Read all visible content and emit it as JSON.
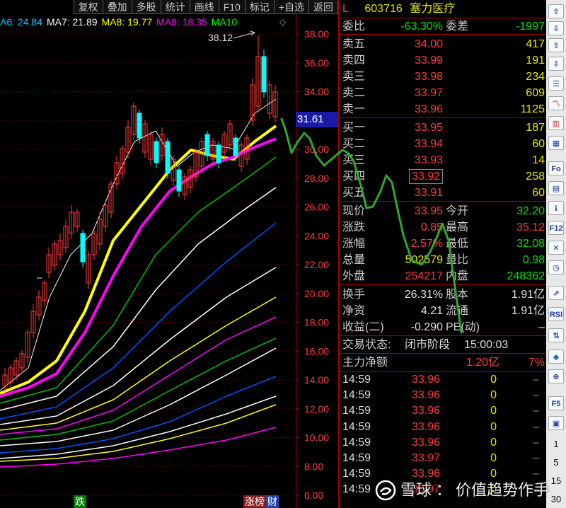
{
  "toolbar": {
    "items": [
      "复权",
      "叠加",
      "多股",
      "统计",
      "画线",
      "F10",
      "标记",
      "+自选",
      "返回"
    ]
  },
  "ma_legend": [
    {
      "label": "A6: 24.84",
      "color": "#00c8ff"
    },
    {
      "label": "MA7: 21.89",
      "color": "#ffffff"
    },
    {
      "label": "MA8: 19.77",
      "color": "#ffff00"
    },
    {
      "label": "MA9: 18.35",
      "color": "#ff00ff"
    },
    {
      "label": "MA10",
      "color": "#00ff00"
    }
  ],
  "legend_arrows": "◇",
  "chart": {
    "high_label": "38.12",
    "price_flag": "31.61",
    "y_ticks": [
      "38.00",
      "36.00",
      "34.00",
      "32.00",
      "30.00",
      "28.00",
      "26.00",
      "24.00",
      "22.00",
      "20.00",
      "18.00",
      "16.00",
      "14.00",
      "12.00",
      "10.00",
      "8.00",
      "6.00"
    ],
    "bottom_tags": [
      "跌",
      "涨榜",
      "财"
    ],
    "colors": {
      "up": "#ff3b3b",
      "down": "#00ffff",
      "axis": "#aa0000"
    }
  },
  "header": {
    "market": "L",
    "code": "603716",
    "name": "塞力医疗"
  },
  "ratio": {
    "label1": "委比",
    "value1": "-63.30%",
    "label2": "委差",
    "value2": "-1997"
  },
  "asks": [
    {
      "label": "卖五",
      "price": "34.00",
      "vol": "417"
    },
    {
      "label": "卖四",
      "price": "33.99",
      "vol": "191"
    },
    {
      "label": "卖三",
      "price": "33.98",
      "vol": "234"
    },
    {
      "label": "卖二",
      "price": "33.97",
      "vol": "609"
    },
    {
      "label": "卖一",
      "price": "33.96",
      "vol": "1125"
    }
  ],
  "bids": [
    {
      "label": "买一",
      "price": "33.95",
      "vol": "187"
    },
    {
      "label": "买二",
      "price": "33.94",
      "vol": "60"
    },
    {
      "label": "买三",
      "price": "33.93",
      "vol": "14"
    },
    {
      "label": "买四",
      "price": "33.92",
      "vol": "258"
    },
    {
      "label": "买五",
      "price": "33.91",
      "vol": "60"
    }
  ],
  "stats1": [
    {
      "l1": "现价",
      "v1": "33.95",
      "c1": "red",
      "l2": "今开",
      "v2": "32.20",
      "c2": "green"
    },
    {
      "l1": "涨跌",
      "v1": "0.85",
      "c1": "red",
      "l2": "最高",
      "v2": "35.12",
      "c2": "red"
    },
    {
      "l1": "涨幅",
      "v1": "2.57%",
      "c1": "red",
      "l2": "最低",
      "v2": "32.08",
      "c2": "green"
    },
    {
      "l1": "总量",
      "v1": "502579",
      "c1": "yellow",
      "l2": "量比",
      "v2": "0.98",
      "c2": "green"
    },
    {
      "l1": "外盘",
      "v1": "254217",
      "c1": "red",
      "l2": "内盘",
      "v2": "248362",
      "c2": "green"
    }
  ],
  "stats2": [
    {
      "l1": "换手",
      "v1": "26.31%",
      "l2": "股本",
      "v2": "1.91亿"
    },
    {
      "l1": "净资",
      "v1": "4.21",
      "l2": "流通",
      "v2": "1.91亿"
    },
    {
      "l1": "收益(二)",
      "v1": "-0.290",
      "l2": "PE(动)",
      "v2": "–"
    }
  ],
  "trade_status": {
    "label": "交易状态:",
    "value": "闭市阶段",
    "time": "15:00:03"
  },
  "main_net": {
    "label": "主力净额",
    "value": "1.20亿",
    "pct": "7%"
  },
  "ticks": [
    {
      "time": "14:59",
      "price": "33.96",
      "vol": "0",
      "flag": "–"
    },
    {
      "time": "14:59",
      "price": "33.96",
      "vol": "0",
      "flag": "–"
    },
    {
      "time": "14:59",
      "price": "33.96",
      "vol": "0",
      "flag": "–"
    },
    {
      "time": "14:59",
      "price": "33.96",
      "vol": "0",
      "flag": "–"
    },
    {
      "time": "14:59",
      "price": "33.96",
      "vol": "0",
      "flag": "–"
    },
    {
      "time": "14:59",
      "price": "33.97",
      "vol": "0",
      "flag": "–"
    },
    {
      "time": "14:59",
      "price": "33.96",
      "vol": "0",
      "flag": "–"
    },
    {
      "time": "14:59",
      "price": "33.97",
      "vol": "0",
      "flag": "–"
    }
  ],
  "side_toolbar": {
    "text_buttons": [
      "Fo",
      "F12",
      "RSI",
      "F5"
    ],
    "period_numbers": [
      "1",
      "5",
      "15",
      "30"
    ]
  },
  "watermark": {
    "brand": "雪球",
    "sep": "：",
    "author": "价值趋势作手"
  }
}
